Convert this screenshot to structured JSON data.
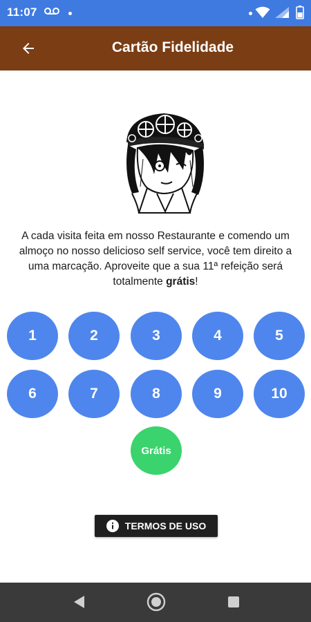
{
  "status_bar": {
    "time": "11:07",
    "icons": [
      "voicemail-icon",
      "notification-dot",
      "wifi-icon",
      "signal-icon",
      "battery-icon"
    ],
    "color": "#3f7ae0"
  },
  "app_bar": {
    "title": "Cartão Fidelidade",
    "back_icon": "arrow-back-icon",
    "color": "#7a3d14"
  },
  "logo": {
    "icon": "chef-character-logo"
  },
  "description": {
    "text_before": "A cada visita feita em nosso Restaurante e comendo um almoço no nosso delicioso self service, você tem direito a uma marcação. Aproveite que a sua 11ª refeição será totalmente ",
    "bold": "grátis",
    "text_after": "!"
  },
  "stamps": {
    "numbers": [
      "1",
      "2",
      "3",
      "4",
      "5",
      "6",
      "7",
      "8",
      "9",
      "10"
    ],
    "free_label": "Grátis",
    "number_color": "#4f86ed",
    "free_color": "#3bd36d"
  },
  "terms": {
    "label": "TERMOS DE USO",
    "icon": "info-icon"
  },
  "nav_bar": {
    "buttons": [
      "back-triangle-icon",
      "home-circle-icon",
      "recents-square-icon"
    ]
  }
}
